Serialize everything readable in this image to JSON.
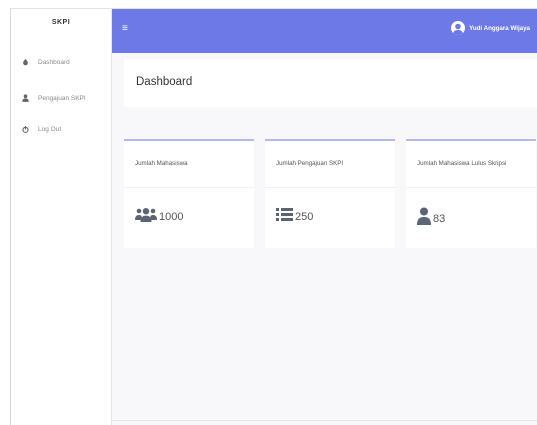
{
  "sidebar": {
    "brand": "SKPI",
    "items": [
      {
        "icon": "dashboard-icon",
        "label": "Dashboard"
      },
      {
        "icon": "user-icon",
        "label": "Pengajuan SKPI"
      },
      {
        "icon": "power-icon",
        "label": "Log Out"
      }
    ]
  },
  "topbar": {
    "user_name": "Yudi Anggara Wijaya",
    "accent_color": "#6d79e6"
  },
  "main": {
    "title": "Dashboard",
    "cards": [
      {
        "label": "Jumlah Mahasiswa",
        "value": "1000",
        "icon": "users-icon"
      },
      {
        "label": "Jumlah Pengajuan SKPI",
        "value": "250",
        "icon": "list-icon"
      },
      {
        "label": "Jumlah Mahasiswa Lulus Skripsi",
        "value": "83",
        "icon": "user-icon"
      }
    ]
  }
}
